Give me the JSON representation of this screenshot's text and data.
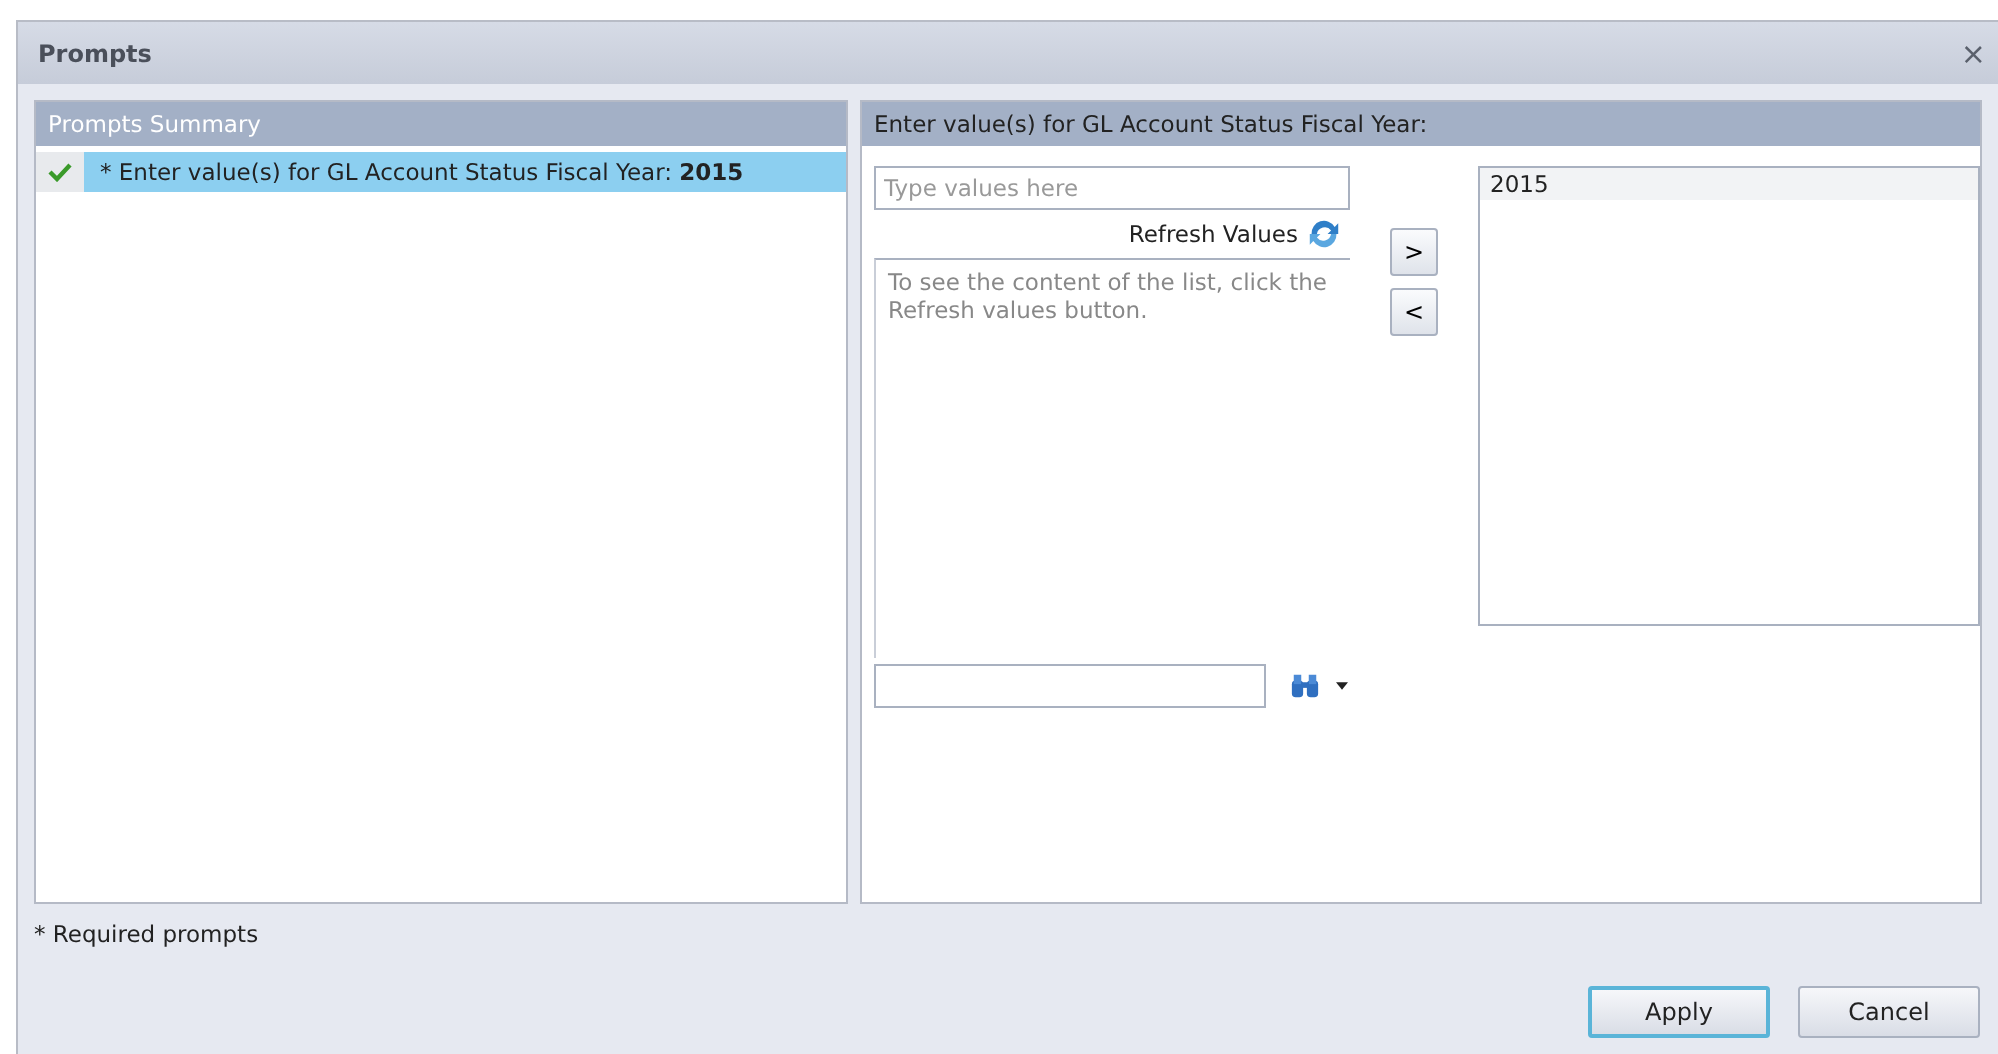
{
  "window": {
    "title": "Prompts",
    "close": "×"
  },
  "summary": {
    "title": "Prompts Summary",
    "items": [
      {
        "text": "* Enter value(s) for GL Account Status Fiscal Year: **2015**",
        "checked": true,
        "selected": true
      }
    ]
  },
  "editor": {
    "title": "Enter value(s) for GL Account Status Fiscal Year:",
    "input": {
      "placeholder": "Type values here"
    },
    "refresh": "Refresh Values",
    "add": ">",
    "remove": "<",
    "list_message": "To see the content of the list, click the Refresh values button.",
    "selected_values": [
      "2015"
    ]
  },
  "footer": {
    "note": "* Required prompts",
    "buttons": [
      {
        "label": "Apply",
        "default": true
      },
      {
        "label": "Cancel",
        "default": false
      }
    ]
  }
}
